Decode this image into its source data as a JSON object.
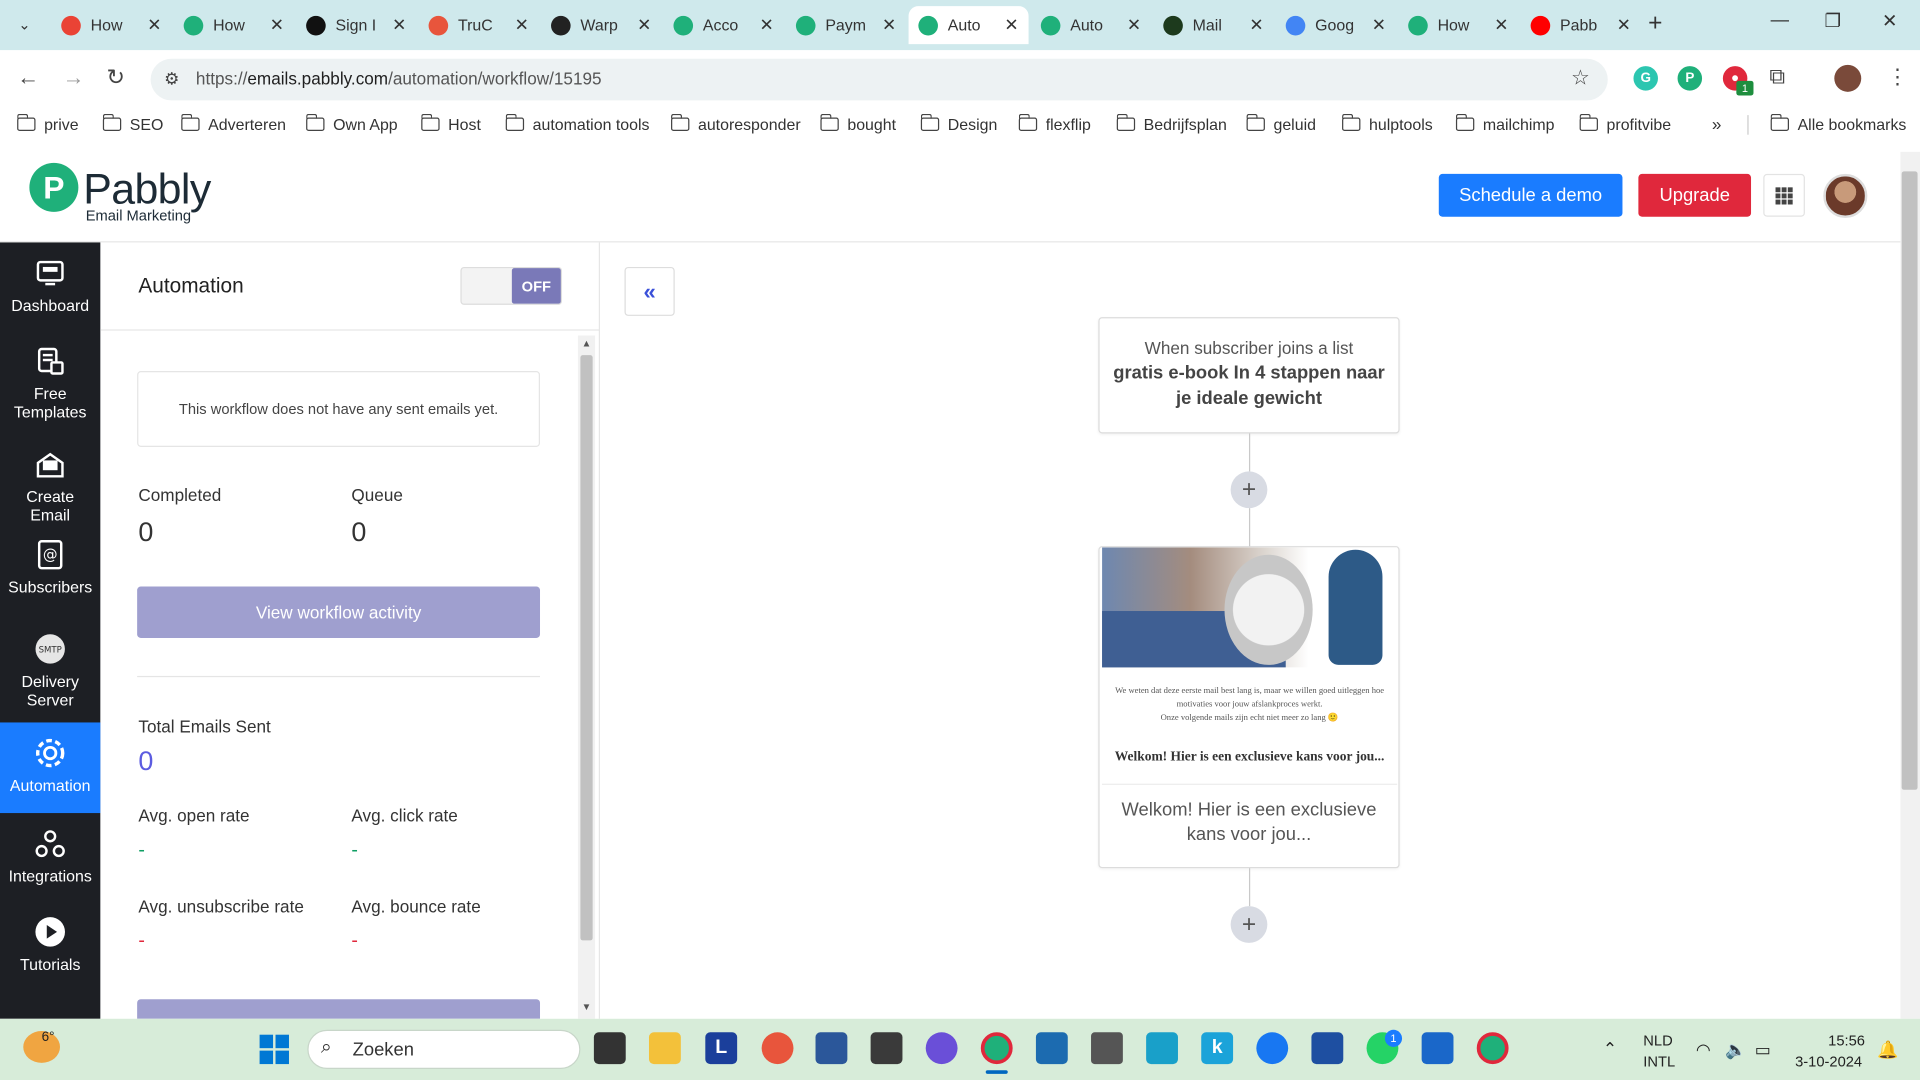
{
  "browser": {
    "tabs": [
      {
        "title": "How",
        "favicon": "gmail-icon",
        "color": "#ea4335"
      },
      {
        "title": "How",
        "favicon": "pabbly-icon",
        "color": "#1fb07a"
      },
      {
        "title": "Sign I",
        "favicon": "notion-icon",
        "color": "#111111"
      },
      {
        "title": "TruC",
        "favicon": "rocket-icon",
        "color": "#e8553c"
      },
      {
        "title": "Warp",
        "favicon": "warp-icon",
        "color": "#222222"
      },
      {
        "title": "Acco",
        "favicon": "pabbly-icon",
        "color": "#1fb07a"
      },
      {
        "title": "Paym",
        "favicon": "pabbly-icon",
        "color": "#1fb07a"
      },
      {
        "title": "Auto",
        "favicon": "pabbly-icon",
        "color": "#1fb07a",
        "active": true
      },
      {
        "title": "Auto",
        "favicon": "pabbly-icon",
        "color": "#1fb07a"
      },
      {
        "title": "Mail",
        "favicon": "mailwizz-icon",
        "color": "#1d3a1d"
      },
      {
        "title": "Goog",
        "favicon": "google-translate-icon",
        "color": "#4285f4"
      },
      {
        "title": "How",
        "favicon": "pabbly-icon",
        "color": "#1fb07a"
      },
      {
        "title": "Pabb",
        "favicon": "youtube-icon",
        "color": "#ff0000"
      }
    ],
    "url_prefix": "https://",
    "url_domain": "emails.pabbly.com",
    "url_path": "/automation/workflow/15195",
    "bookmarks": [
      "prive",
      "SEO",
      "Adverteren",
      "Own App",
      "Host",
      "automation tools",
      "autoresponder",
      "bought",
      "Design",
      "flexflip",
      "Bedrijfsplan",
      "geluid",
      "hulptools",
      "mailchimp",
      "profitvibe"
    ],
    "all_bookmarks": "Alle bookmarks",
    "ext_badge": "1"
  },
  "app": {
    "logo_letter": "P",
    "logo_text": "Pabbly",
    "logo_sub": "Email Marketing",
    "schedule_demo": "Schedule a demo",
    "upgrade": "Upgrade",
    "colors": {
      "demo": "#1a7cff",
      "upgrade": "#e0283c",
      "nav_bg": "#1d1f24",
      "nav_active": "#1a7cff",
      "toggle_off": "#7a79b8"
    }
  },
  "nav": [
    {
      "label": "Dashboard",
      "icon": "dashboard-icon"
    },
    {
      "label": "Free Templates",
      "icon": "templates-icon"
    },
    {
      "label": "Create Email",
      "icon": "create-email-icon"
    },
    {
      "label": "Subscribers",
      "icon": "subscribers-icon"
    },
    {
      "label": "Delivery Server",
      "icon": "smtp-icon",
      "icon_text": "SMTP"
    },
    {
      "label": "Automation",
      "icon": "automation-gear-icon",
      "active": true
    },
    {
      "label": "Integrations",
      "icon": "integrations-icon"
    },
    {
      "label": "Tutorials",
      "icon": "play-icon"
    }
  ],
  "panel": {
    "title": "Automation",
    "toggle": "OFF",
    "no_emails": "This workflow does not have any sent emails yet.",
    "completed_label": "Completed",
    "completed_value": "0",
    "queue_label": "Queue",
    "queue_value": "0",
    "view_activity": "View workflow activity",
    "total_sent_label": "Total Emails Sent",
    "total_sent_value": "0",
    "open_rate_label": "Avg. open rate",
    "open_rate_value": "-",
    "click_rate_label": "Avg. click rate",
    "click_rate_value": "-",
    "unsub_rate_label": "Avg. unsubscribe rate",
    "unsub_rate_value": "-",
    "bounce_rate_label": "Avg. bounce rate",
    "bounce_rate_value": "-"
  },
  "workflow": {
    "collapse": "«",
    "trigger_sub": "When subscriber joins a list",
    "trigger_main": "gratis e-book In 4 stappen naar je ideale gewicht",
    "add": "+",
    "email_preview_text_1": "We weten dat deze eerste mail best lang is, maar we willen goed uitleggen hoe motivaties voor jouw afslankproces werkt.",
    "email_preview_text_2": "Onze volgende mails zijn echt niet meer zo lang 🙂",
    "email_preview_heading": "Welkom! Hier is een exclusieve kans voor jou...",
    "email_caption": "Welkom! Hier is een exclusieve kans voor jou..."
  },
  "taskbar": {
    "weather": "6°",
    "search": "Zoeken",
    "lang_1": "NLD",
    "lang_2": "INTL",
    "time": "15:56",
    "date": "3-10-2024",
    "whatsapp_badge": "1"
  }
}
